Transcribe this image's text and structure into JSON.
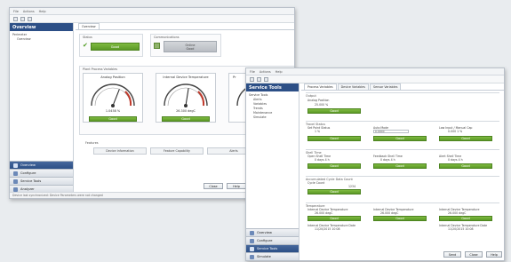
{
  "back_window": {
    "menu": [
      "File",
      "Actions",
      "Help"
    ],
    "pane_title": "Overview",
    "tree": [
      "Perimeter",
      "Overview"
    ],
    "nav": [
      "Overview",
      "Configure",
      "Service Tools",
      "Analyzer"
    ],
    "tabs": [
      "Overview"
    ],
    "status_label": "Status",
    "status_value": "Good",
    "comm_label": "Communications",
    "comm_value": "Online",
    "comm_sub": "Good",
    "gauges_label": "Plant Process Variables",
    "gauges": [
      {
        "title": "Analog Position",
        "value": "1.0458 %",
        "status": "Good",
        "level": 0.62
      },
      {
        "title": "Internal Device Temperature",
        "value": "26.300 degC",
        "status": "Good",
        "level": 0.55
      },
      {
        "title": "Pr",
        "value": "",
        "status": "",
        "level": 0.5
      }
    ],
    "features_label": "Features",
    "features": [
      "Device Information",
      "Feature Capability",
      "Alerts"
    ],
    "ok": "Close",
    "help": "Help",
    "statusbar": "Device last synchronized: Device Parameters were not changed"
  },
  "front_window": {
    "menu": [
      "File",
      "Actions",
      "Help"
    ],
    "pane_title": "Service Tools",
    "tree": [
      "Service Tools",
      "Alerts",
      "Variables",
      "Trends",
      "Maintenance",
      "Simulate"
    ],
    "nav": [
      "Overview",
      "Configure",
      "Service Tools",
      "Simulate"
    ],
    "tabs": [
      "Process Variables",
      "Device Variables",
      "Sensor Variables"
    ],
    "groups": [
      {
        "title": "Output",
        "fields": [
          {
            "label": "Analog Position",
            "value": "25.000 %"
          }
        ],
        "status": [
          "Good"
        ]
      },
      {
        "title": "Travel Status",
        "fields": [
          {
            "label": "Set Point Status",
            "value": "1 %"
          },
          {
            "label": "Auto Mode",
            "value": "0.0000"
          },
          {
            "label": "Low Input / Manual Cap",
            "value": "0.000 1 %"
          }
        ],
        "status": [
          "Good",
          "Good",
          "Good"
        ]
      },
      {
        "title": "Shell Time",
        "fields": [
          {
            "label": "Open Shell Time",
            "value": "0 days 4 h"
          },
          {
            "label": "Feedback Shell Time",
            "value": "0 days 4 h"
          },
          {
            "label": "Alert Shell Time",
            "value": "0 days 4 h"
          }
        ],
        "status": [
          "Good",
          "Good",
          "Good"
        ]
      },
      {
        "title": "Accumulated Cycle Data Count",
        "fields": [
          {
            "label": "Cycle Count",
            "value": "1234"
          }
        ],
        "status": [
          "Good"
        ]
      },
      {
        "title": "Temperature",
        "fields": [
          {
            "label": "Internal Device Temperature",
            "value": "26.000 degC"
          },
          {
            "label": "Internal Device Temperature",
            "value": "26.000 degC"
          },
          {
            "label": "Internal Device Temperature",
            "value": "26.000 degC"
          }
        ],
        "status": [
          "Good",
          "Good",
          "Good"
        ]
      }
    ],
    "extra": [
      {
        "label": "Internal Device Temperature Date",
        "value": "11/20/2015 10:08"
      },
      {
        "label": "Internal Device Temperature Date",
        "value": "11/20/2015 10:08"
      }
    ],
    "buttons": [
      "Send",
      "Close",
      "Help"
    ]
  }
}
